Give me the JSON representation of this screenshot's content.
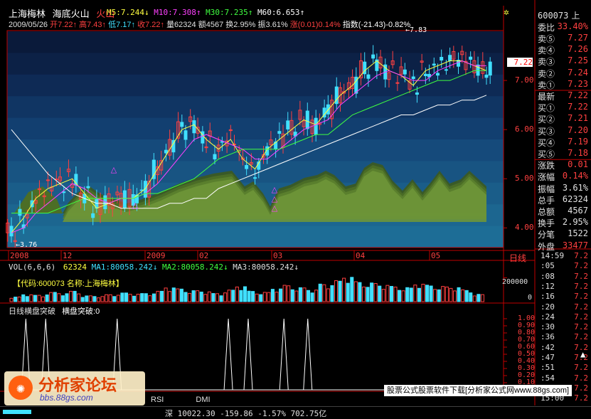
{
  "header": {
    "name": "上海梅林",
    "menu1": "海底火山",
    "menu2": "火山",
    "ma5": "M5:7.244",
    "ma10": "M10:7.308",
    "ma30": "M30:7.235",
    "ma60": "M60:6.653",
    "date": "2009/05/26",
    "open": "开7.22",
    "high": "高7.43",
    "low": "低7.17",
    "close": "收7.22",
    "volume": "量62324",
    "amount": "额4567",
    "turnover": "换2.95%",
    "amplitude": "振3.61%",
    "change": "涨(0.01)0.14%",
    "index": "指数(-21.43)-0.82%"
  },
  "price_panel": {
    "max_label": "7.83",
    "min_label": "3.76",
    "current_label": "7.22",
    "y_ticks": [
      "7.00",
      "6.00",
      "5.00",
      "4.00"
    ],
    "x_ticks": [
      "2008",
      "12",
      "2009",
      "02",
      "03",
      "04",
      "05"
    ],
    "period": "日线",
    "signal_marker": "△"
  },
  "volume_panel": {
    "header": "VOL(6,6,6)",
    "vol": "62324",
    "ma1": "MA1:80058.242",
    "ma2": "MA2:80058.242",
    "ma3": "MA3:80058.242",
    "code_note": "【代码:600073  名称:上海梅林】",
    "y_ticks": [
      "200000",
      "0"
    ]
  },
  "indicator_panel": {
    "title": "日线横盘突破",
    "series_label": "横盘突破:0",
    "y_ticks": [
      "1.00",
      "0.90",
      "0.80",
      "0.70",
      "0.60",
      "0.50",
      "0.40",
      "0.30",
      "0.20",
      "0.10"
    ]
  },
  "quote": {
    "code": "600073",
    "code_suffix": "上",
    "wei_label": "委比",
    "wei_value": "33.40%",
    "rows": [
      {
        "k": "卖⑤",
        "v": "7.27",
        "c": "#ff4040"
      },
      {
        "k": "卖④",
        "v": "7.26",
        "c": "#ff4040"
      },
      {
        "k": "卖③",
        "v": "7.25",
        "c": "#ff4040"
      },
      {
        "k": "卖②",
        "v": "7.24",
        "c": "#ff4040"
      },
      {
        "k": "卖①",
        "v": "7.23",
        "c": "#ff4040"
      },
      {
        "k": "最新",
        "v": "7.22",
        "c": "#ff4040"
      },
      {
        "k": "买①",
        "v": "7.22",
        "c": "#ff4040"
      },
      {
        "k": "买②",
        "v": "7.21",
        "c": "#ff4040"
      },
      {
        "k": "买③",
        "v": "7.20",
        "c": "#ff4040"
      },
      {
        "k": "买④",
        "v": "7.19",
        "c": "#ff4040"
      },
      {
        "k": "买⑤",
        "v": "7.18",
        "c": "#ff4040"
      },
      {
        "k": "涨跌",
        "v": "0.01",
        "c": "#ff4040"
      },
      {
        "k": "涨幅",
        "v": "0.14%",
        "c": "#ff4040"
      },
      {
        "k": "振幅",
        "v": "3.61%",
        "c": "#e0e0e0"
      },
      {
        "k": "总手",
        "v": "62324",
        "c": "#e0e0e0"
      },
      {
        "k": "总额",
        "v": "4567",
        "c": "#e0e0e0"
      },
      {
        "k": "换手",
        "v": "2.95%",
        "c": "#e0e0e0"
      },
      {
        "k": "分笔",
        "v": "1522",
        "c": "#e0e0e0"
      },
      {
        "k": "外盘",
        "v": "33477",
        "c": "#ff4040"
      }
    ]
  },
  "ticks": [
    {
      "t": "14:59",
      "p": "7.2"
    },
    {
      "t": ":05",
      "p": "7.2"
    },
    {
      "t": ":08",
      "p": "7.2"
    },
    {
      "t": ":12",
      "p": "7.2"
    },
    {
      "t": ":16",
      "p": "7.2"
    },
    {
      "t": ":20",
      "p": "7.2"
    },
    {
      "t": ":24",
      "p": "7.2"
    },
    {
      "t": ":30",
      "p": "7.2"
    },
    {
      "t": ":36",
      "p": "7.2"
    },
    {
      "t": ":42",
      "p": "7.2"
    },
    {
      "t": ":47",
      "p": "7.2"
    },
    {
      "t": ":51",
      "p": "7.2"
    },
    {
      "t": ":54",
      "p": "7.2"
    },
    {
      "t": ":57",
      "p": "7.2"
    },
    {
      "t": "15:00",
      "p": "7.2"
    }
  ],
  "tabs": [
    "RSI",
    "DMI"
  ],
  "status": "深  10022.30  -159.86  -1.57%  702.75亿",
  "watermark": {
    "logo": "分析家论坛",
    "site": "bbs.88gs.com",
    "banner": "股票公式股票软件下载[分析家公式网www.88gs.com]"
  },
  "colors": {
    "up": "#ff4040",
    "down": "#40e0ff",
    "ma5": "#ffff40",
    "ma10": "#ff40ff",
    "ma30": "#40ff40",
    "ma60": "#ffffff",
    "frame": "#c00000"
  },
  "chart_data": [
    {
      "type": "candlestick",
      "title": "上海梅林 日线",
      "ylim": [
        3.6,
        8.0
      ],
      "x_ticks": [
        "2008",
        "12",
        "2009",
        "02",
        "03",
        "04",
        "05"
      ],
      "series": [
        {
          "name": "M5",
          "values": [
            3.9,
            4.2,
            4.6,
            4.8,
            4.9,
            5.0,
            4.7,
            4.4,
            4.5,
            4.6,
            4.6,
            4.8,
            5.2,
            5.6,
            6.0,
            6.1,
            5.8,
            5.6,
            5.8,
            5.4,
            5.2,
            5.6,
            5.8,
            6.0,
            6.2,
            6.1,
            6.4,
            6.7,
            6.9,
            7.2,
            7.4,
            7.2,
            7.1,
            6.9,
            7.2,
            7.3,
            7.4,
            7.4,
            7.3,
            7.2
          ]
        },
        {
          "name": "M10",
          "values": [
            3.9,
            4.0,
            4.3,
            4.5,
            4.7,
            4.9,
            4.8,
            4.6,
            4.5,
            4.6,
            4.6,
            4.7,
            4.9,
            5.2,
            5.5,
            5.8,
            5.9,
            5.8,
            5.7,
            5.6,
            5.4,
            5.4,
            5.6,
            5.8,
            6.0,
            6.1,
            6.2,
            6.5,
            6.7,
            6.9,
            7.1,
            7.2,
            7.1,
            7.0,
            7.0,
            7.2,
            7.3,
            7.4,
            7.3,
            7.3
          ]
        },
        {
          "name": "M30",
          "values": [
            4.3,
            4.3,
            4.3,
            4.3,
            4.4,
            4.5,
            4.6,
            4.6,
            4.6,
            4.6,
            4.6,
            4.7,
            4.7,
            4.8,
            4.9,
            5.0,
            5.2,
            5.4,
            5.5,
            5.6,
            5.6,
            5.6,
            5.6,
            5.7,
            5.8,
            5.9,
            5.9,
            6.1,
            6.3,
            6.4,
            6.5,
            6.6,
            6.7,
            6.8,
            6.9,
            7.0,
            7.0,
            7.1,
            7.2,
            7.2
          ]
        },
        {
          "name": "M60",
          "values": [
            6.0,
            5.7,
            5.4,
            5.1,
            4.9,
            4.7,
            4.6,
            4.5,
            4.5,
            4.4,
            4.4,
            4.4,
            4.4,
            4.5,
            4.5,
            4.6,
            4.6,
            4.8,
            4.9,
            5.0,
            5.1,
            5.2,
            5.3,
            5.4,
            5.5,
            5.6,
            5.7,
            5.8,
            5.9,
            6.0,
            6.1,
            6.2,
            6.3,
            6.3,
            6.4,
            6.5,
            6.5,
            6.6,
            6.6,
            6.7
          ]
        }
      ]
    },
    {
      "type": "bar",
      "title": "VOL(6,6,6)",
      "ylim": [
        0,
        250000
      ],
      "values": [
        40000,
        60000,
        55000,
        80000,
        70000,
        90000,
        50000,
        45000,
        60000,
        75000,
        65000,
        70000,
        90000,
        120000,
        110000,
        95000,
        85000,
        70000,
        100000,
        130000,
        90000,
        80000,
        110000,
        140000,
        120000,
        100000,
        150000,
        180000,
        210000,
        170000,
        160000,
        140000,
        130000,
        120000,
        150000,
        140000,
        130000,
        120000,
        100000,
        62324
      ]
    },
    {
      "type": "line",
      "title": "日线横盘突破",
      "ylim": [
        0,
        1.05
      ],
      "spikes_at": [
        4,
        9,
        27,
        55,
        60,
        69,
        75
      ]
    }
  ]
}
